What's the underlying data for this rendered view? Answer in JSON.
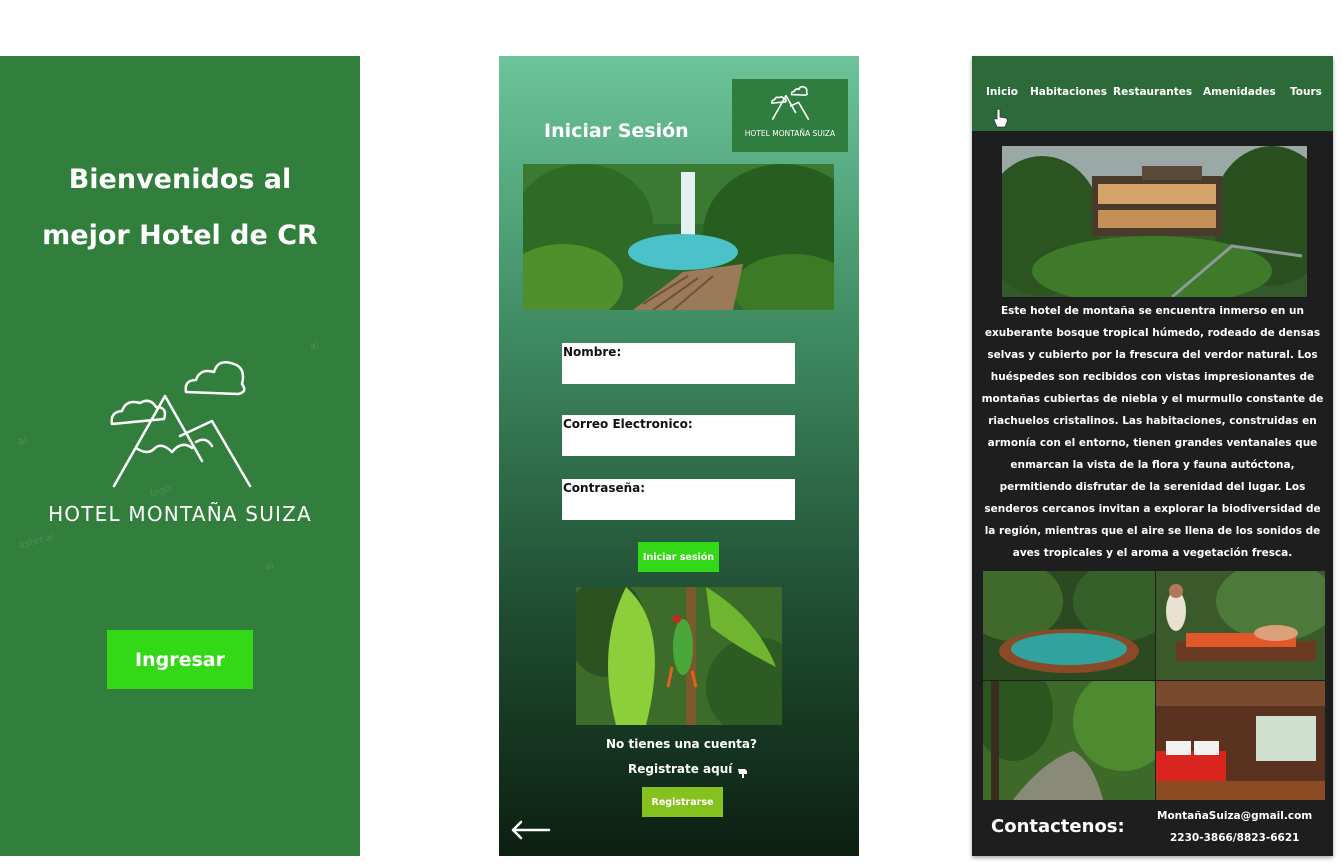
{
  "welcome": {
    "title_line1": "Bienvenidos al",
    "title_line2": "mejor Hotel de CR",
    "logo_text": "HOTEL MONTAÑA SUIZA",
    "enter_button": "Ingresar",
    "colors": {
      "background": "#317e3d",
      "button": "#33d916"
    }
  },
  "login": {
    "heading": "Iniciar Sesión",
    "logo_text": "HOTEL MONTAÑA SUIZA",
    "fields": {
      "name_label": "Nombre:",
      "email_label": "Correo Electronico:",
      "password_label": "Contraseña:"
    },
    "login_button": "Iniciar sesión",
    "no_account": "No tienes una cuenta?",
    "register_here": "Registrate aquí",
    "register_button": "Registrarse",
    "icons": {
      "back": "arrow-left-icon",
      "pointer": "pointing-hand-icon"
    }
  },
  "home": {
    "nav": [
      "Inicio",
      "Habitaciones",
      "Restaurantes",
      "Amenidades",
      "Tours"
    ],
    "description": "Este hotel de montaña se encuentra inmerso en un exuberante bosque tropical húmedo, rodeado de densas selvas y cubierto por la frescura del verdor natural. Los huéspedes son recibidos con vistas impresionantes de montañas cubiertas de niebla y el murmullo constante de riachuelos cristalinos. Las habitaciones, construidas en armonía con el entorno, tienen grandes ventanales que enmarcan la vista de la flora y fauna autóctona, permitiendo disfrutar de la serenidad del lugar. Los senderos cercanos invitan a explorar la biodiversidad de la región, mientras que el aire se llena de los sonidos de aves tropicales y el aroma a vegetación fresca.",
    "contact_title": "Contactenos:",
    "email": "MontañaSuiza@gmail.com",
    "phone": "2230-3866/8823-6621",
    "colors": {
      "nav": "#2d6a39",
      "background": "#1e1e1e"
    }
  }
}
